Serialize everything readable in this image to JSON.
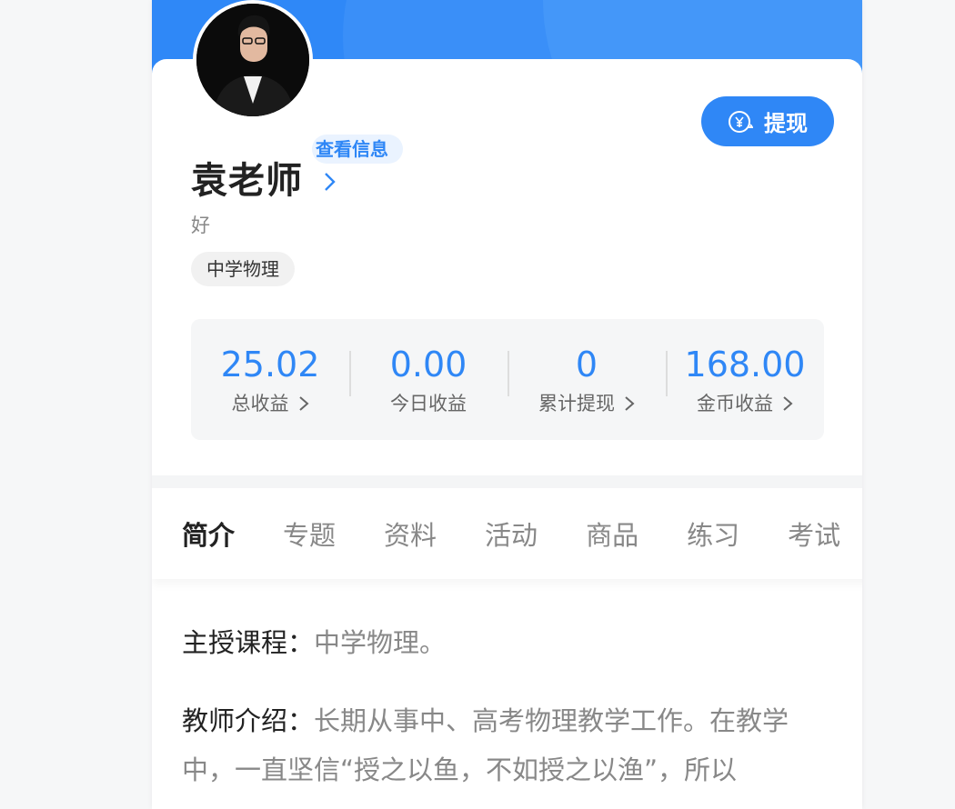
{
  "profile": {
    "name": "袁老师",
    "view_info": "查看信息",
    "bio": "好",
    "tag": "中学物理",
    "withdraw_label": "提现"
  },
  "stats": [
    {
      "value": "25.02",
      "label": "总收益",
      "arrow": true
    },
    {
      "value": "0.00",
      "label": "今日收益",
      "arrow": false
    },
    {
      "value": "0",
      "label": "累计提现",
      "arrow": true
    },
    {
      "value": "168.00",
      "label": "金币收益",
      "arrow": true
    }
  ],
  "tabs": [
    "简介",
    "专题",
    "资料",
    "活动",
    "商品",
    "练习",
    "考试"
  ],
  "intro": {
    "course_label": "主授课程：",
    "course_value": "中学物理。",
    "teacher_label": "教师介绍：",
    "teacher_value": "长期从事中、高考物理教学工作。在教学中，一直坚信“授之以鱼，不如授之以渔”，所以"
  },
  "colors": {
    "accent": "#2f87f6",
    "header": "#2f88f7"
  }
}
